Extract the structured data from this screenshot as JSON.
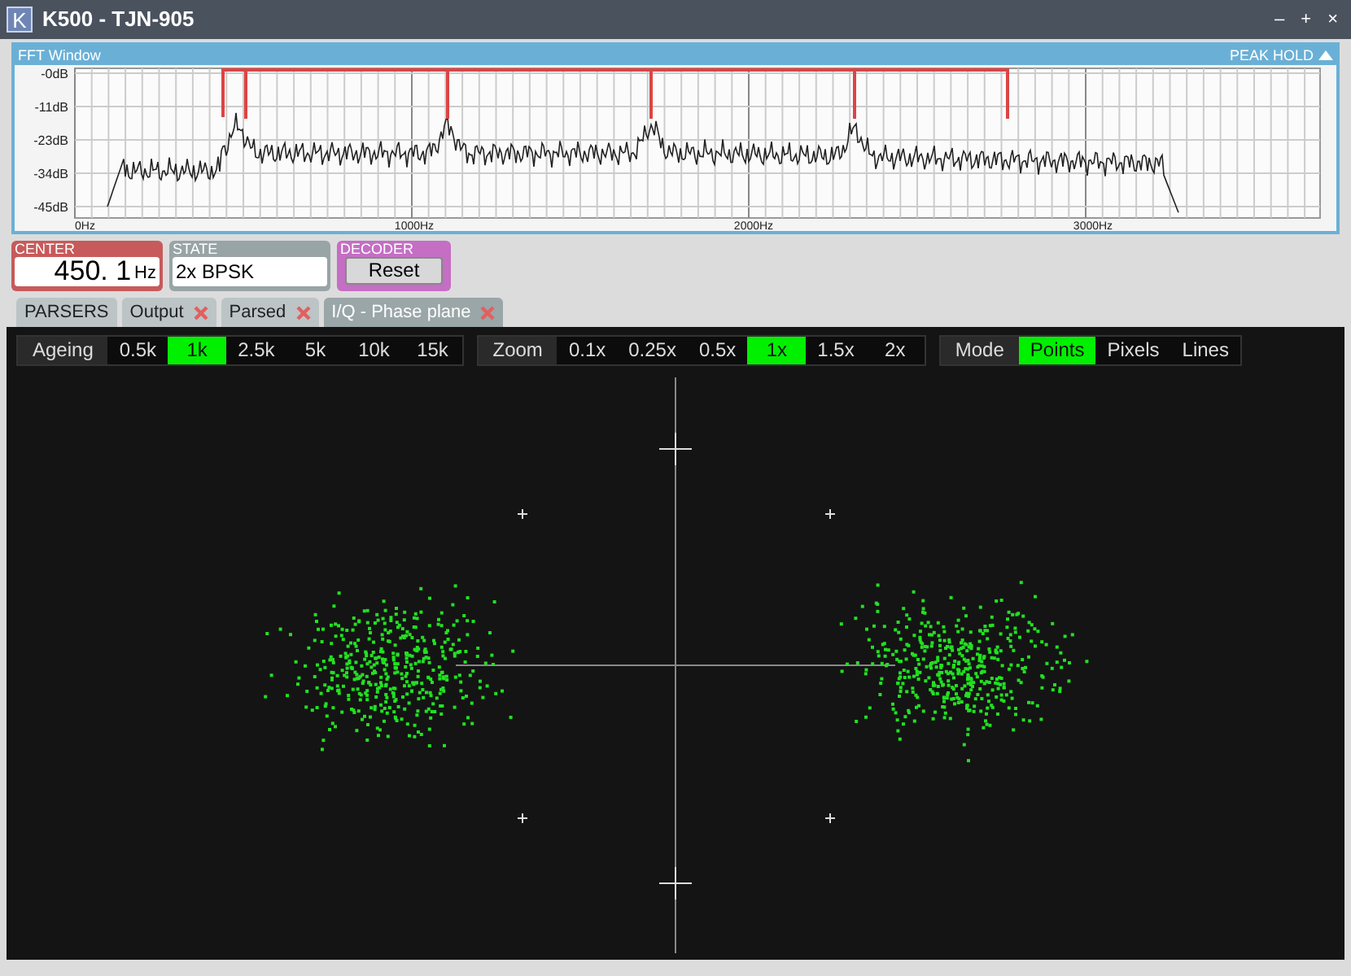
{
  "window": {
    "logo": "K",
    "title": "K500 - TJN-905",
    "controls": [
      "–",
      "+",
      "×"
    ]
  },
  "fft": {
    "title": "FFT Window",
    "peak_hold": "PEAK HOLD",
    "y_labels": [
      "-0dB",
      "-11dB",
      "-23dB",
      "-34dB",
      "-45dB"
    ],
    "x_labels": [
      "0Hz",
      "1000Hz",
      "2000Hz",
      "3000Hz"
    ]
  },
  "center": {
    "label": "CENTER",
    "value": "450. 1",
    "unit": "Hz"
  },
  "state": {
    "label": "STATE",
    "value": "2x BPSK"
  },
  "decoder": {
    "label": "DECODER",
    "button": "Reset"
  },
  "tabs": [
    {
      "label": "PARSERS",
      "closable": false,
      "selected": false
    },
    {
      "label": "Output",
      "closable": true,
      "selected": false
    },
    {
      "label": "Parsed",
      "closable": true,
      "selected": false
    },
    {
      "label": "I/Q - Phase plane",
      "closable": true,
      "selected": true
    }
  ],
  "toolbars": [
    {
      "label": "Ageing",
      "options": [
        {
          "label": "0.5k",
          "selected": false
        },
        {
          "label": "1k",
          "selected": true
        },
        {
          "label": "2.5k",
          "selected": false
        },
        {
          "label": "5k",
          "selected": false
        },
        {
          "label": "10k",
          "selected": false
        },
        {
          "label": "15k",
          "selected": false
        }
      ]
    },
    {
      "label": "Zoom",
      "options": [
        {
          "label": "0.1x",
          "selected": false
        },
        {
          "label": "0.25x",
          "selected": false
        },
        {
          "label": "0.5x",
          "selected": false
        },
        {
          "label": "1x",
          "selected": true
        },
        {
          "label": "1.5x",
          "selected": false
        },
        {
          "label": "2x",
          "selected": false
        }
      ]
    },
    {
      "label": "Mode",
      "options": [
        {
          "label": "Points",
          "selected": true
        },
        {
          "label": "Pixels",
          "selected": false
        },
        {
          "label": "Lines",
          "selected": false
        }
      ]
    }
  ]
}
